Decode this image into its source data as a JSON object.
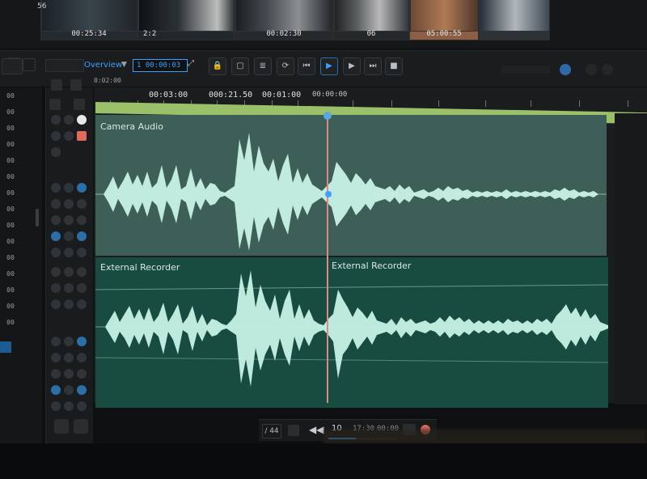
{
  "preview": {
    "timecodes": [
      "56",
      "00:25:34",
      "2:2",
      "00:02:30",
      "06",
      "05:00:55"
    ]
  },
  "toolbar": {
    "menu_label": "Overview",
    "timecode": "1 00:00:03",
    "ruler_start": "0:02:00"
  },
  "ruler": {
    "labels": [
      "00:03:00",
      "000:21.50",
      "00:01:00",
      "00:00:00"
    ]
  },
  "tracks": [
    {
      "name": "Camera Audio"
    },
    {
      "name": "External Recorder"
    },
    {
      "name": "External Recorder"
    }
  ],
  "transport": {
    "left_label": "/ 44",
    "position": "10",
    "time_a": "17:30",
    "time_b": "00:00"
  },
  "gutter": {
    "numbers": [
      "00",
      "00",
      "00",
      "00",
      "00",
      "00",
      "00",
      "00",
      "00",
      "00",
      "00",
      "00",
      "00",
      "00",
      "00"
    ]
  },
  "colors": {
    "accent_blue": "#3ba0ff",
    "track1_bg": "#3e5e58",
    "track2_bg": "#184c40",
    "waveform": "#c7f2e6",
    "green_bar": "#9bc06a",
    "playhead": "#d98a8a"
  }
}
